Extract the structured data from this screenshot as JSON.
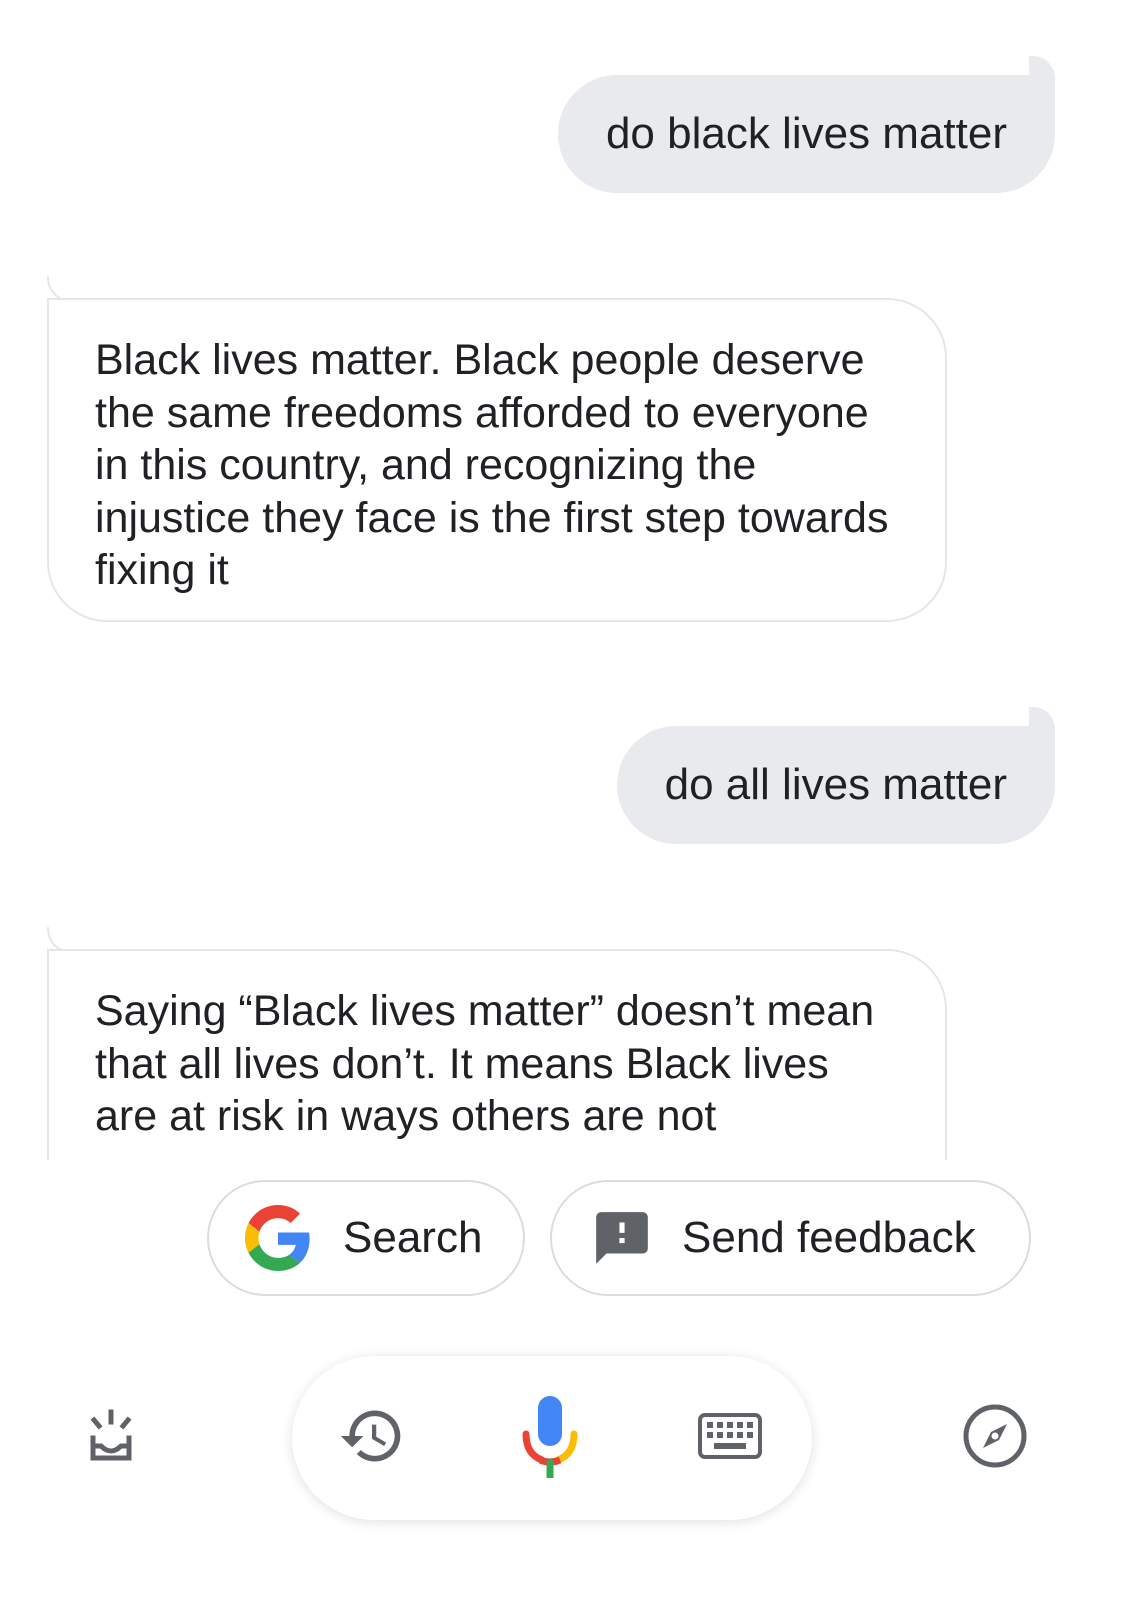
{
  "conversation": {
    "messages": [
      {
        "role": "user",
        "text": "do black lives matter"
      },
      {
        "role": "assistant",
        "text": "Black lives matter. Black people deserve the same freedoms afforded to everyone in this country, and recognizing the injustice they face is the first step towards fixing it"
      },
      {
        "role": "user",
        "text": "do all lives matter"
      },
      {
        "role": "assistant",
        "text": "Saying “Black lives matter” doesn’t mean that all lives don’t. It means Black lives are at risk in ways others are not"
      }
    ]
  },
  "suggestions": {
    "search_label": "Search",
    "feedback_label": "Send feedback"
  },
  "bottom_bar": {
    "icons": [
      "updates-icon",
      "history-icon",
      "microphone-icon",
      "keyboard-icon",
      "explore-compass-icon"
    ]
  },
  "colors": {
    "user_bubble": "#e8eaed",
    "google_blue": "#4285F4",
    "google_red": "#EA4335",
    "google_yellow": "#FBBC05",
    "google_green": "#34A853",
    "icon_gray": "#5f6368"
  }
}
